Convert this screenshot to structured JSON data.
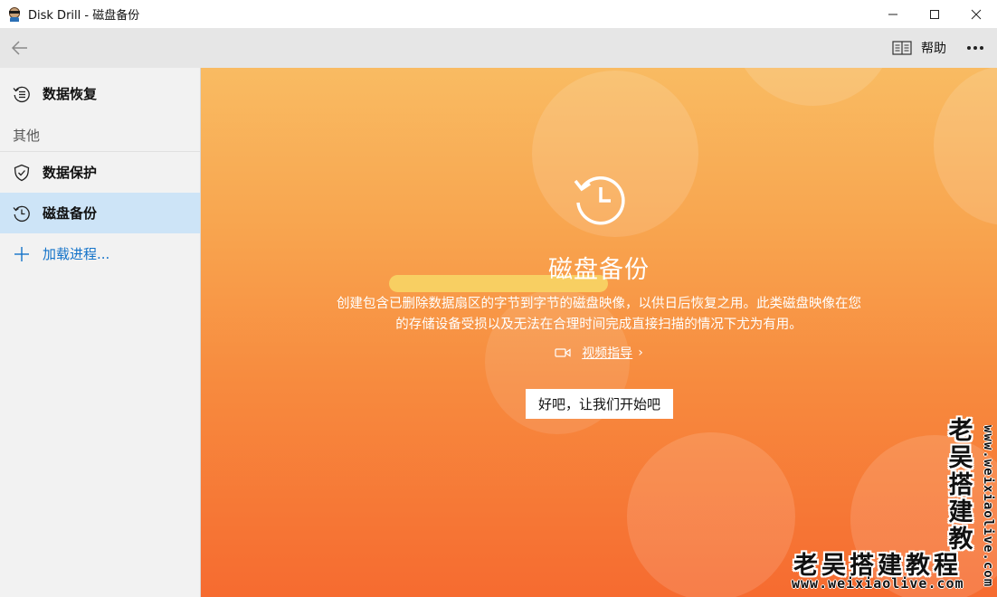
{
  "window": {
    "title": "Disk Drill - 磁盘备份",
    "minimize_icon": "minimize-icon",
    "maximize_icon": "maximize-icon",
    "close_icon": "close-icon"
  },
  "toolbar": {
    "back_icon": "back-arrow-icon",
    "help_label": "帮助",
    "help_icon": "book-icon",
    "more_icon": "more-icon"
  },
  "sidebar": {
    "items": [
      {
        "label": "数据恢复",
        "icon": "recovery-icon",
        "active": false
      },
      {
        "label": "数据保护",
        "icon": "shield-icon",
        "active": false
      },
      {
        "label": "磁盘备份",
        "icon": "backup-clock-icon",
        "active": true
      }
    ],
    "section_label": "其他",
    "add_label": "加载进程...",
    "add_icon": "plus-icon"
  },
  "main": {
    "icon": "backup-clock-icon",
    "title": "磁盘备份",
    "description": "创建包含已删除数据扇区的字节到字节的磁盘映像，以供日后恢复之用。此类磁盘映像在您的存储设备受损以及无法在合理时间完成直接扫描的情况下尤为有用。",
    "video_icon": "video-camera-icon",
    "video_label": "视频指导",
    "chevron": "›",
    "start_button": "好吧，让我们开始吧"
  },
  "watermark": {
    "text": "老吴搭建教程",
    "vertical_chars": [
      "老",
      "吴",
      "搭",
      "建",
      "教"
    ],
    "url": "www.weixiaolive.com"
  },
  "colors": {
    "gradient_top": "#f9bb62",
    "gradient_bottom": "#f66b30",
    "accent_blue": "#1473c9",
    "active_item_bg": "#cde4f7"
  }
}
